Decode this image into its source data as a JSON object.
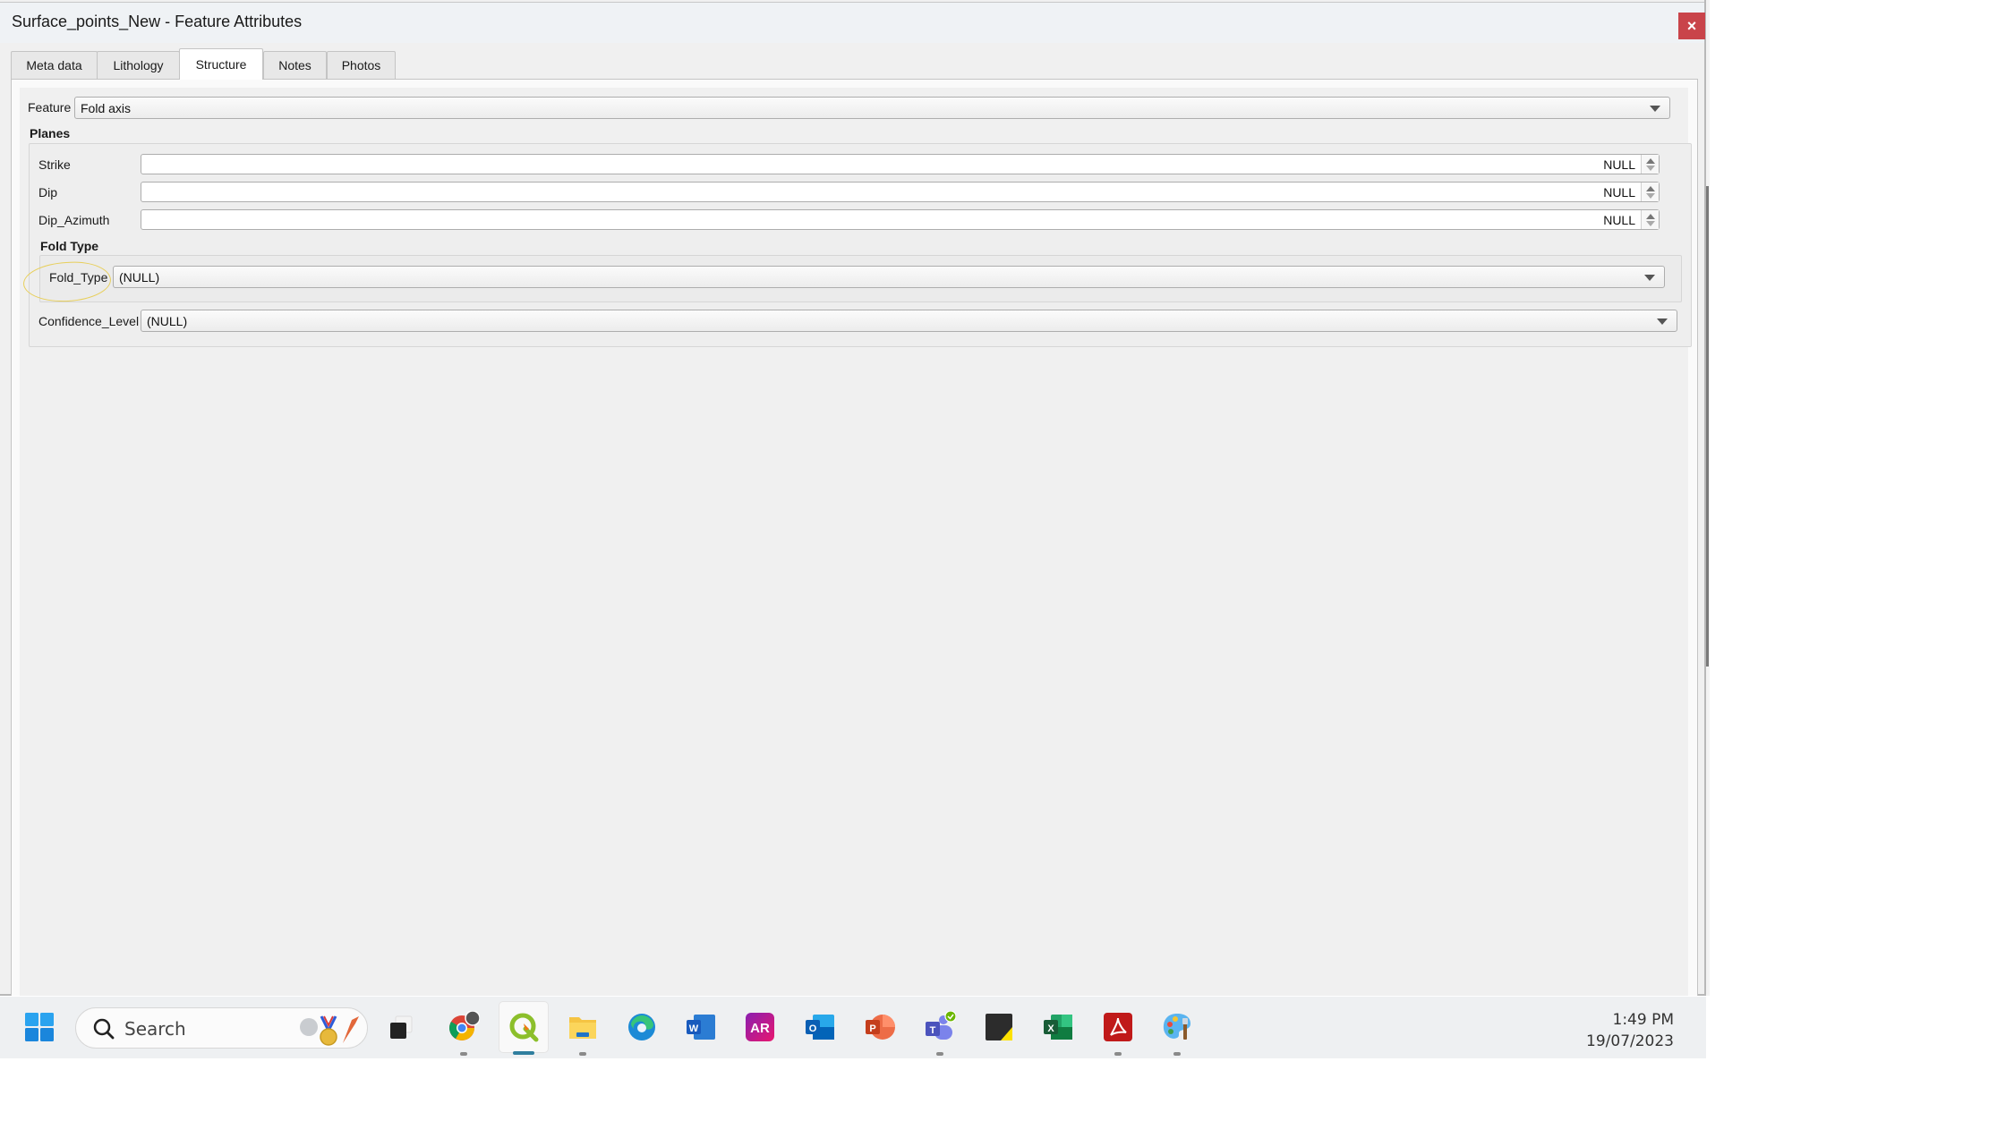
{
  "window": {
    "title": "Surface_points_New - Feature Attributes",
    "close_label": "×"
  },
  "tabs": [
    {
      "label": "Meta data",
      "active": false
    },
    {
      "label": "Lithology",
      "active": false
    },
    {
      "label": "Structure",
      "active": true
    },
    {
      "label": "Notes",
      "active": false
    },
    {
      "label": "Photos",
      "active": false
    }
  ],
  "form": {
    "feature": {
      "label": "Feature",
      "value": "Fold axis"
    },
    "planes": {
      "title": "Planes",
      "fields": [
        {
          "label": "Strike",
          "value": "NULL"
        },
        {
          "label": "Dip",
          "value": "NULL"
        },
        {
          "label": "Dip_Azimuth",
          "value": "NULL"
        }
      ]
    },
    "fold_type_group": {
      "title": "Fold Type",
      "field": {
        "label": "Fold_Type",
        "value": "(NULL)"
      }
    },
    "confidence_level": {
      "label": "Confidence_Level",
      "value": "(NULL)"
    }
  },
  "taskbar": {
    "search_placeholder": "Search",
    "apps": [
      {
        "name": "task-view",
        "running": false
      },
      {
        "name": "chrome",
        "running": true
      },
      {
        "name": "qgis",
        "running": true,
        "active": true
      },
      {
        "name": "file-explorer",
        "running": true
      },
      {
        "name": "edge",
        "running": false
      },
      {
        "name": "word",
        "running": false
      },
      {
        "name": "acrobat-reader-ar",
        "label": "AR",
        "running": false
      },
      {
        "name": "outlook",
        "running": false
      },
      {
        "name": "powerpoint",
        "running": false
      },
      {
        "name": "teams",
        "running": true
      },
      {
        "name": "sticky-notes",
        "running": false
      },
      {
        "name": "excel",
        "running": false
      },
      {
        "name": "adobe-acrobat",
        "running": true
      },
      {
        "name": "paint",
        "running": true
      }
    ],
    "app_letters": {
      "word": "W",
      "ar": "AR",
      "outlook": "O",
      "powerpoint": "P",
      "teams": "T",
      "excel": "X"
    },
    "clock": {
      "time": "1:49 PM",
      "date": "19/07/2023"
    }
  },
  "colors": {
    "close_button": "#c9444a",
    "highlight_annotation": "#e8cf5a",
    "qgis_active_indicator": "#2f7e9e"
  }
}
